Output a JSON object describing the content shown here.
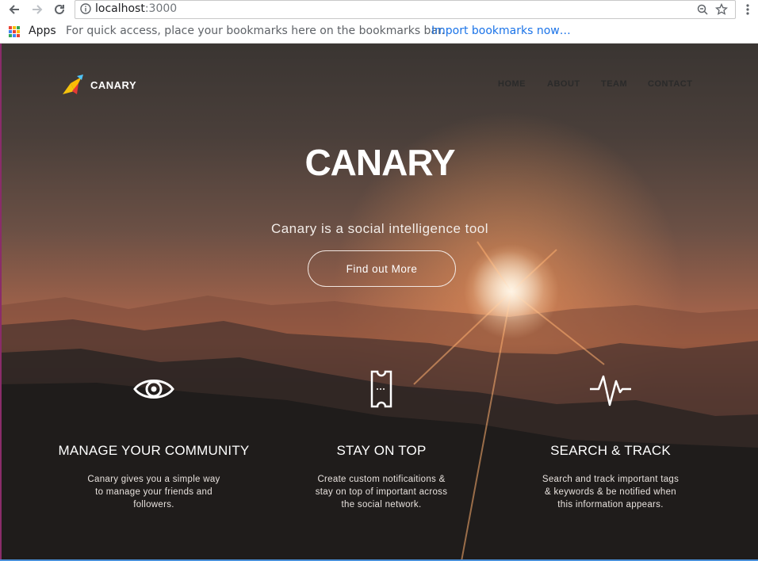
{
  "browser": {
    "url_host": "localhost",
    "url_port": ":3000",
    "bookmarks_apps_label": "Apps",
    "bookmarks_hint": "For quick access, place your bookmarks here on the bookmarks bar.",
    "bookmarks_import_link": "Import bookmarks now…",
    "icons": [
      "back-icon",
      "forward-icon",
      "reload-icon",
      "info-icon",
      "zoom-icon",
      "star-icon",
      "menu-icon",
      "apps-icon"
    ]
  },
  "site": {
    "brand": "CANARY",
    "nav": [
      "HOME",
      "ABOUT",
      "TEAM",
      "CONTACT"
    ],
    "hero": {
      "title": "CANARY",
      "subtitle": "Canary is a social intelligence tool",
      "cta": "Find out More"
    },
    "features": [
      {
        "icon": "eye-icon",
        "title": "MANAGE YOUR COMMUNITY",
        "description": "Canary gives you a simple way to manage your friends and followers."
      },
      {
        "icon": "ticket-icon",
        "title": "STAY ON TOP",
        "description": "Create custom notificaitions & stay on top of important across the social network."
      },
      {
        "icon": "pulse-icon",
        "title": "SEARCH & TRACK",
        "description": "Search and track important tags & keywords & be notified when this information appears."
      }
    ],
    "colors": {
      "nav_text": "#2a2a2a",
      "hero_text": "#ffffff",
      "link_blue": "#1a73e8"
    }
  }
}
